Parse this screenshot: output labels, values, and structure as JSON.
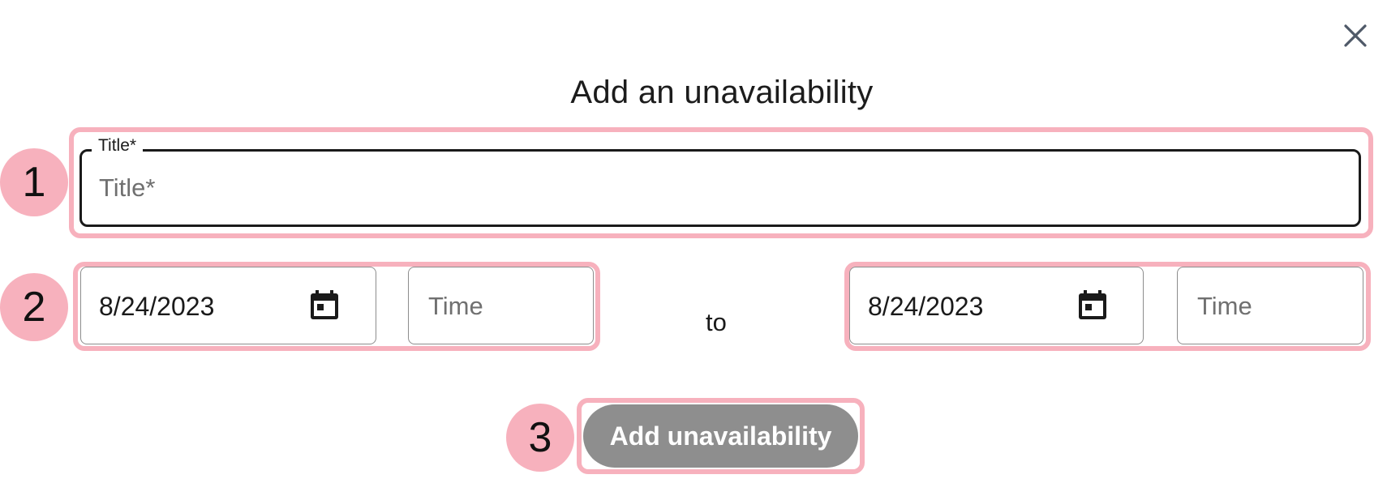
{
  "dialog": {
    "title": "Add an unavailability",
    "close_icon": "close-icon"
  },
  "title_field": {
    "label": "Title*",
    "placeholder": "Title*",
    "value": ""
  },
  "range": {
    "start": {
      "date": "8/24/2023",
      "time_placeholder": "Time",
      "date_icon": "calendar-icon"
    },
    "separator": "to",
    "end": {
      "date": "8/24/2023",
      "time_placeholder": "Time",
      "date_icon": "calendar-icon"
    }
  },
  "submit": {
    "label": "Add unavailability",
    "state": "disabled"
  },
  "annotations": {
    "badge1": "1",
    "badge2": "2",
    "badge3": "3"
  },
  "colors": {
    "highlight": "#f7b1bd",
    "button_disabled": "#8e8e8e",
    "text": "#1a1a1a",
    "placeholder": "#707070"
  }
}
